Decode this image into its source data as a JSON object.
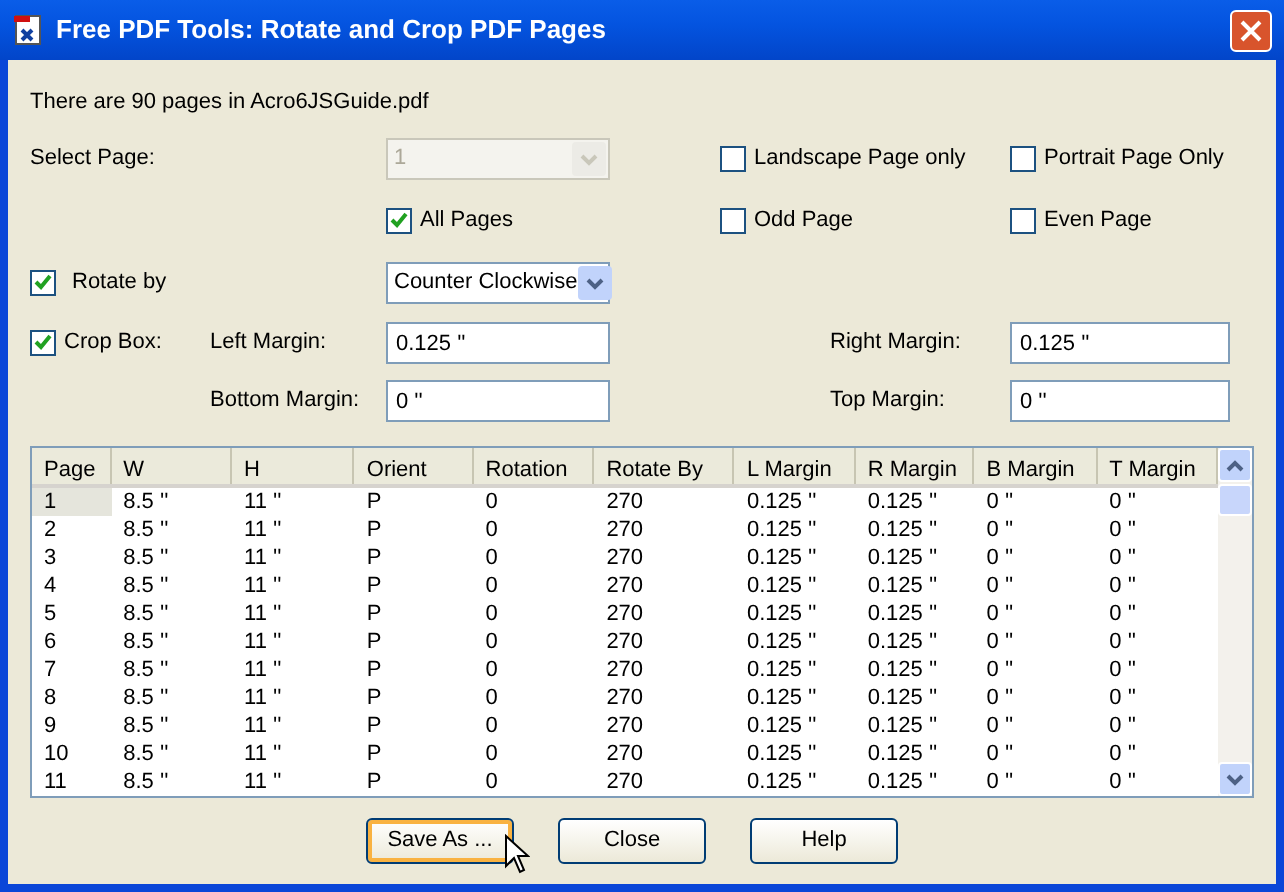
{
  "window": {
    "title": "Free PDF Tools: Rotate and Crop PDF Pages"
  },
  "info": "There are 90 pages in Acro6JSGuide.pdf",
  "select_page": {
    "label": "Select Page:",
    "value": "1",
    "disabled": true
  },
  "filters": [
    {
      "label": "Landscape Page only",
      "checked": false
    },
    {
      "label": "Portrait Page Only",
      "checked": false
    },
    {
      "label": "All Pages",
      "checked": true
    },
    {
      "label": "Odd Page",
      "checked": false
    },
    {
      "label": "Even Page",
      "checked": false
    }
  ],
  "rotate": {
    "label": "Rotate by",
    "checked": true,
    "value": "Counter Clockwise"
  },
  "crop": {
    "label": "Crop Box:",
    "checked": true
  },
  "margins": [
    {
      "label": "Left Margin:",
      "value": "0.125 ''"
    },
    {
      "label": "Right Margin:",
      "value": "0.125 ''"
    },
    {
      "label": "Bottom Margin:",
      "value": "0 ''"
    },
    {
      "label": "Top Margin:",
      "value": "0 ''"
    }
  ],
  "table": {
    "columns": [
      "Page",
      "W",
      "H",
      "Orient",
      "Rotation",
      "Rotate By",
      "L Margin",
      "R Margin",
      "B Margin",
      "T Margin"
    ],
    "rows": [
      {
        "selected": true,
        "cells": [
          "1",
          "8.5 ''",
          "11 ''",
          "P",
          "0",
          "270",
          "0.125 ''",
          "0.125 ''",
          "0 ''",
          "0 ''"
        ]
      },
      {
        "selected": false,
        "cells": [
          "2",
          "8.5 ''",
          "11 ''",
          "P",
          "0",
          "270",
          "0.125 ''",
          "0.125 ''",
          "0 ''",
          "0 ''"
        ]
      },
      {
        "selected": false,
        "cells": [
          "3",
          "8.5 ''",
          "11 ''",
          "P",
          "0",
          "270",
          "0.125 ''",
          "0.125 ''",
          "0 ''",
          "0 ''"
        ]
      },
      {
        "selected": false,
        "cells": [
          "4",
          "8.5 ''",
          "11 ''",
          "P",
          "0",
          "270",
          "0.125 ''",
          "0.125 ''",
          "0 ''",
          "0 ''"
        ]
      },
      {
        "selected": false,
        "cells": [
          "5",
          "8.5 ''",
          "11 ''",
          "P",
          "0",
          "270",
          "0.125 ''",
          "0.125 ''",
          "0 ''",
          "0 ''"
        ]
      },
      {
        "selected": false,
        "cells": [
          "6",
          "8.5 ''",
          "11 ''",
          "P",
          "0",
          "270",
          "0.125 ''",
          "0.125 ''",
          "0 ''",
          "0 ''"
        ]
      },
      {
        "selected": false,
        "cells": [
          "7",
          "8.5 ''",
          "11 ''",
          "P",
          "0",
          "270",
          "0.125 ''",
          "0.125 ''",
          "0 ''",
          "0 ''"
        ]
      },
      {
        "selected": false,
        "cells": [
          "8",
          "8.5 ''",
          "11 ''",
          "P",
          "0",
          "270",
          "0.125 ''",
          "0.125 ''",
          "0 ''",
          "0 ''"
        ]
      },
      {
        "selected": false,
        "cells": [
          "9",
          "8.5 ''",
          "11 ''",
          "P",
          "0",
          "270",
          "0.125 ''",
          "0.125 ''",
          "0 ''",
          "0 ''"
        ]
      },
      {
        "selected": false,
        "cells": [
          "10",
          "8.5 ''",
          "11 ''",
          "P",
          "0",
          "270",
          "0.125 ''",
          "0.125 ''",
          "0 ''",
          "0 ''"
        ]
      },
      {
        "selected": false,
        "cells": [
          "11",
          "8.5 ''",
          "11 ''",
          "P",
          "0",
          "270",
          "0.125 ''",
          "0.125 ''",
          "0 ''",
          "0 ''"
        ]
      }
    ]
  },
  "buttons": [
    {
      "label": "Save As ...",
      "focused": true
    },
    {
      "label": "Close",
      "focused": false
    },
    {
      "label": "Help",
      "focused": false
    }
  ]
}
